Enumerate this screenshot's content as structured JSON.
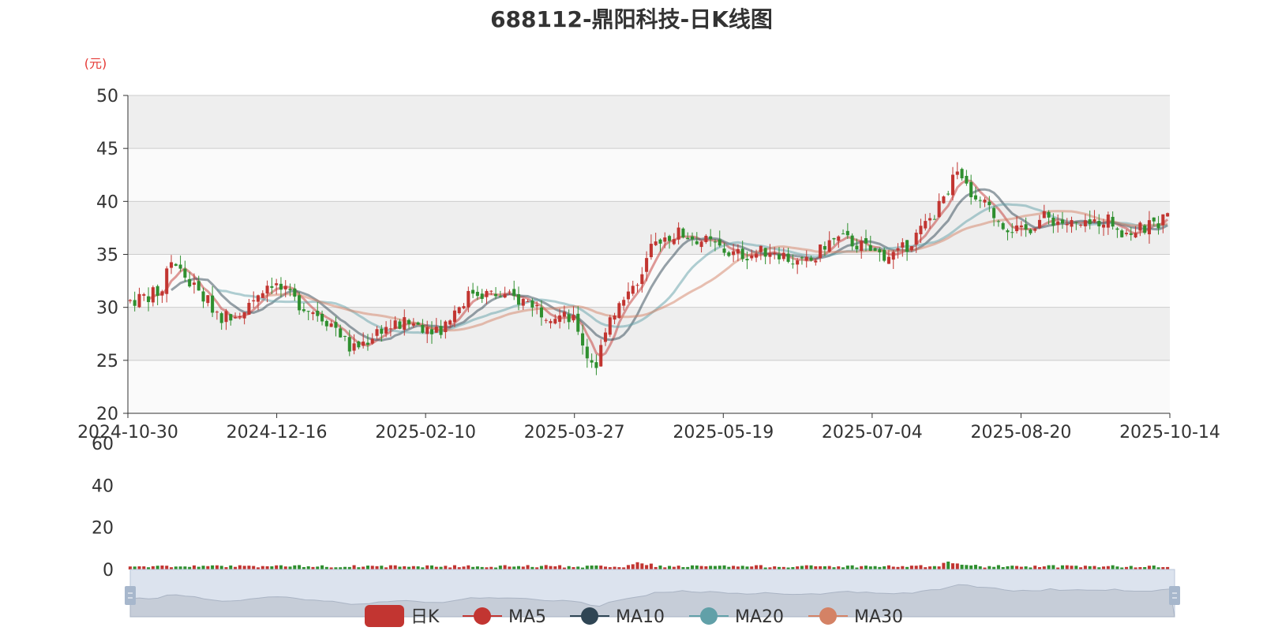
{
  "chart_data": {
    "type": "candlestick",
    "title": "688112-鼎阳科技-日K线图",
    "y_unit": "(元)",
    "main_axis": {
      "ylim": [
        20,
        50
      ],
      "yticks": [
        "50",
        "45",
        "40",
        "35",
        "30",
        "25",
        "20"
      ],
      "xticks": [
        "2024-10-30",
        "2024-12-16",
        "2025-02-10",
        "2025-03-27",
        "2025-05-19",
        "2025-07-04",
        "2025-08-20",
        "2025-10-14"
      ]
    },
    "volume_axis": {
      "ylim": [
        0,
        60
      ],
      "yticks": [
        "60",
        "40",
        "20",
        "0"
      ]
    },
    "legend": {
      "placement": "bottom-center",
      "items": [
        {
          "name": "日K",
          "color": "#c23531"
        },
        {
          "name": "MA5",
          "color": "#c23531"
        },
        {
          "name": "MA10",
          "color": "#2f4554"
        },
        {
          "name": "MA20",
          "color": "#61a0a8"
        },
        {
          "name": "MA30",
          "color": "#d48265"
        }
      ]
    },
    "colors": {
      "up": "#c23531",
      "down": "#2f8f2f"
    },
    "price_path": [
      {
        "x": 0,
        "y": 30.6
      },
      {
        "x": 0.03,
        "y": 31.5
      },
      {
        "x": 0.04,
        "y": 34.5
      },
      {
        "x": 0.06,
        "y": 32.0
      },
      {
        "x": 0.08,
        "y": 30.0
      },
      {
        "x": 0.09,
        "y": 29.0
      },
      {
        "x": 0.11,
        "y": 30.0
      },
      {
        "x": 0.13,
        "y": 32.0
      },
      {
        "x": 0.135,
        "y": 32.5
      },
      {
        "x": 0.16,
        "y": 30.5
      },
      {
        "x": 0.18,
        "y": 29.5
      },
      {
        "x": 0.2,
        "y": 28.0
      },
      {
        "x": 0.21,
        "y": 26.3
      },
      {
        "x": 0.215,
        "y": 26.0
      },
      {
        "x": 0.23,
        "y": 27.0
      },
      {
        "x": 0.24,
        "y": 28.0
      },
      {
        "x": 0.27,
        "y": 28.5
      },
      {
        "x": 0.3,
        "y": 28.0
      },
      {
        "x": 0.315,
        "y": 30.0
      },
      {
        "x": 0.33,
        "y": 31.5
      },
      {
        "x": 0.36,
        "y": 31.0
      },
      {
        "x": 0.385,
        "y": 30.5
      },
      {
        "x": 0.4,
        "y": 29.5
      },
      {
        "x": 0.42,
        "y": 29.0
      },
      {
        "x": 0.43,
        "y": 28.5
      },
      {
        "x": 0.44,
        "y": 25.5
      },
      {
        "x": 0.45,
        "y": 24.5
      },
      {
        "x": 0.46,
        "y": 29.0
      },
      {
        "x": 0.48,
        "y": 31.0
      },
      {
        "x": 0.49,
        "y": 32.0
      },
      {
        "x": 0.5,
        "y": 35.0
      },
      {
        "x": 0.51,
        "y": 36.5
      },
      {
        "x": 0.53,
        "y": 37.0
      },
      {
        "x": 0.56,
        "y": 36.0
      },
      {
        "x": 0.58,
        "y": 35.0
      },
      {
        "x": 0.6,
        "y": 35.0
      },
      {
        "x": 0.62,
        "y": 35.5
      },
      {
        "x": 0.645,
        "y": 34.0
      },
      {
        "x": 0.66,
        "y": 34.5
      },
      {
        "x": 0.67,
        "y": 36.0
      },
      {
        "x": 0.685,
        "y": 36.5
      },
      {
        "x": 0.7,
        "y": 36.0
      },
      {
        "x": 0.72,
        "y": 35.0
      },
      {
        "x": 0.74,
        "y": 35.0
      },
      {
        "x": 0.76,
        "y": 37.0
      },
      {
        "x": 0.78,
        "y": 39.5
      },
      {
        "x": 0.795,
        "y": 42.5
      },
      {
        "x": 0.8,
        "y": 42.0
      },
      {
        "x": 0.82,
        "y": 40.0
      },
      {
        "x": 0.84,
        "y": 38.0
      },
      {
        "x": 0.86,
        "y": 37.0
      },
      {
        "x": 0.88,
        "y": 38.5
      },
      {
        "x": 0.9,
        "y": 38.0
      },
      {
        "x": 0.92,
        "y": 37.5
      },
      {
        "x": 0.94,
        "y": 38.5
      },
      {
        "x": 0.96,
        "y": 37.0
      },
      {
        "x": 0.98,
        "y": 37.5
      },
      {
        "x": 1.0,
        "y": 38.5
      }
    ],
    "candle_count": 228,
    "volume_level": 1.5,
    "volume_spikes": [
      {
        "x": 0.49,
        "v": 3.0
      },
      {
        "x": 0.5,
        "v": 2.5
      },
      {
        "x": 0.485,
        "v": 2.0
      },
      {
        "x": 0.79,
        "v": 3.5
      },
      {
        "x": 0.8,
        "v": 2.5
      },
      {
        "x": 0.81,
        "v": 2.0
      },
      {
        "x": 0.03,
        "v": 2.0
      },
      {
        "x": 0.11,
        "v": 1.8
      }
    ]
  }
}
